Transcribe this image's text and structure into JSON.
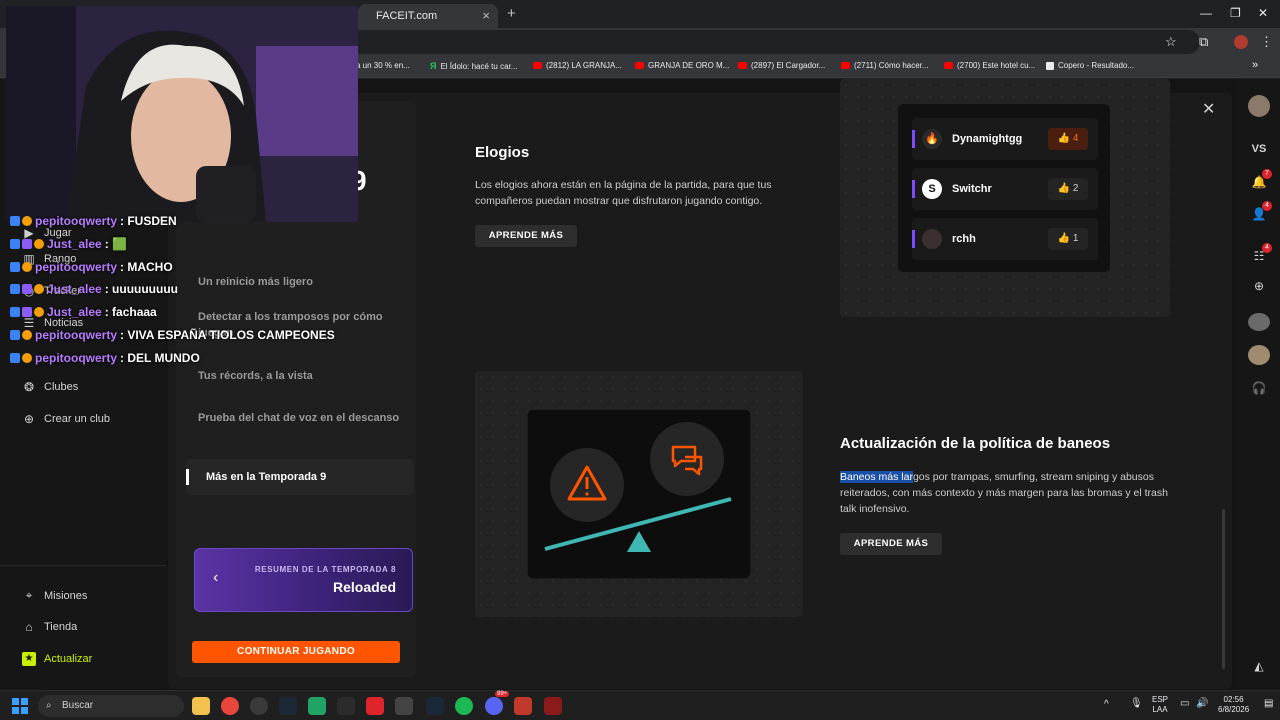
{
  "browser": {
    "tab_title": "FACEIT.com",
    "tab_close": "×",
    "new_tab": "+",
    "bookmarks": [
      {
        "label": "a un 30 % en...",
        "kind": "none"
      },
      {
        "label": "El Ídolo: hacé tu car...",
        "kind": "gr"
      },
      {
        "label": "(2812) LA GRANJA...",
        "kind": "yt"
      },
      {
        "label": "GRANJA DE ORO M...",
        "kind": "yt"
      },
      {
        "label": "(2897) El Cargador...",
        "kind": "yt"
      },
      {
        "label": "(2711) Cómo hacer...",
        "kind": "yt"
      },
      {
        "label": "(2700) Este hotel cu...",
        "kind": "yt"
      },
      {
        "label": "Copero - Resultado...",
        "kind": "cp"
      }
    ],
    "more_bookmarks": "»"
  },
  "sidebar": {
    "items": [
      {
        "label": "Jugar",
        "icon": "play-icon"
      },
      {
        "label": "Rango",
        "icon": "rank-icon"
      },
      {
        "label": "Tracker",
        "icon": "tracker-icon"
      },
      {
        "label": "Noticias",
        "icon": "news-icon"
      },
      {
        "label": "Clubes",
        "icon": "clubs-icon"
      },
      {
        "label": "Crear un club",
        "icon": "plus-circle-icon"
      }
    ],
    "bottom": [
      {
        "label": "Misiones",
        "icon": "missions-icon"
      },
      {
        "label": "Tienda",
        "icon": "shop-icon"
      },
      {
        "label": "Actualizar",
        "icon": "upgrade-icon"
      }
    ]
  },
  "rightbar": {
    "initials": "VS",
    "notif_badge": "7",
    "friends_badge": "4",
    "party_badge": "4"
  },
  "modal": {
    "big_number": "9",
    "toc": [
      "Un reinicio más ligero",
      "Detectar a los tramposos por cómo juegan",
      "Tus récords, a la vista",
      "Prueba del chat de voz en el descanso",
      "Más en la Temporada 9"
    ],
    "season_card": {
      "kicker": "RESUMEN DE LA TEMPORADA 8",
      "title": "Reloaded"
    },
    "continue_button": "CONTINUAR JUGANDO",
    "praise": {
      "title": "Elogios",
      "body": "Los elogios ahora están en la página de la partida, para que tus compañeros puedan mostrar que disfrutaron jugando contigo.",
      "button": "APRENDE MÁS",
      "players": [
        {
          "name": "Dynamightgg",
          "likes": "4",
          "active": true
        },
        {
          "name": "Switchr",
          "likes": "2",
          "active": false
        },
        {
          "name": "rchh",
          "likes": "1",
          "active": false
        }
      ]
    },
    "ban": {
      "title": "Actualización de la política de baneos",
      "body_highlight": "Baneos más lar",
      "body_rest": "gos por trampas, smurfing, stream sniping y abusos reiterados, con más contexto y más margen para las bromas y el trash talk inofensivo.",
      "button": "APRENDE MÁS"
    }
  },
  "chat": [
    {
      "user": "pepitooqwerty",
      "msg": ": FUSDEN"
    },
    {
      "user": "Just_alee",
      "msg": ": 🟩"
    },
    {
      "user": "pepitooqwerty",
      "msg": ": MACHO"
    },
    {
      "user": "Just_alee",
      "msg": ": uuuuuuuuu"
    },
    {
      "user": "Just_alee",
      "msg": ": fachaaa"
    },
    {
      "user": "pepitooqwerty",
      "msg": ": VIVA ESPAÑA TIOLOS CAMPEONES"
    },
    {
      "user": "pepitooqwerty",
      "msg": ": DEL MUNDO"
    }
  ],
  "taskbar": {
    "search_placeholder": "Buscar",
    "lang": "ESP",
    "lang2": "LAA",
    "time": "02:56",
    "date": "6/8/2026",
    "discord_badge": "99+"
  },
  "colors": {
    "accent": "#ff5500",
    "upgrade": "#c7f000",
    "purple": "#7b4dff",
    "teal": "#3fb8b4"
  }
}
